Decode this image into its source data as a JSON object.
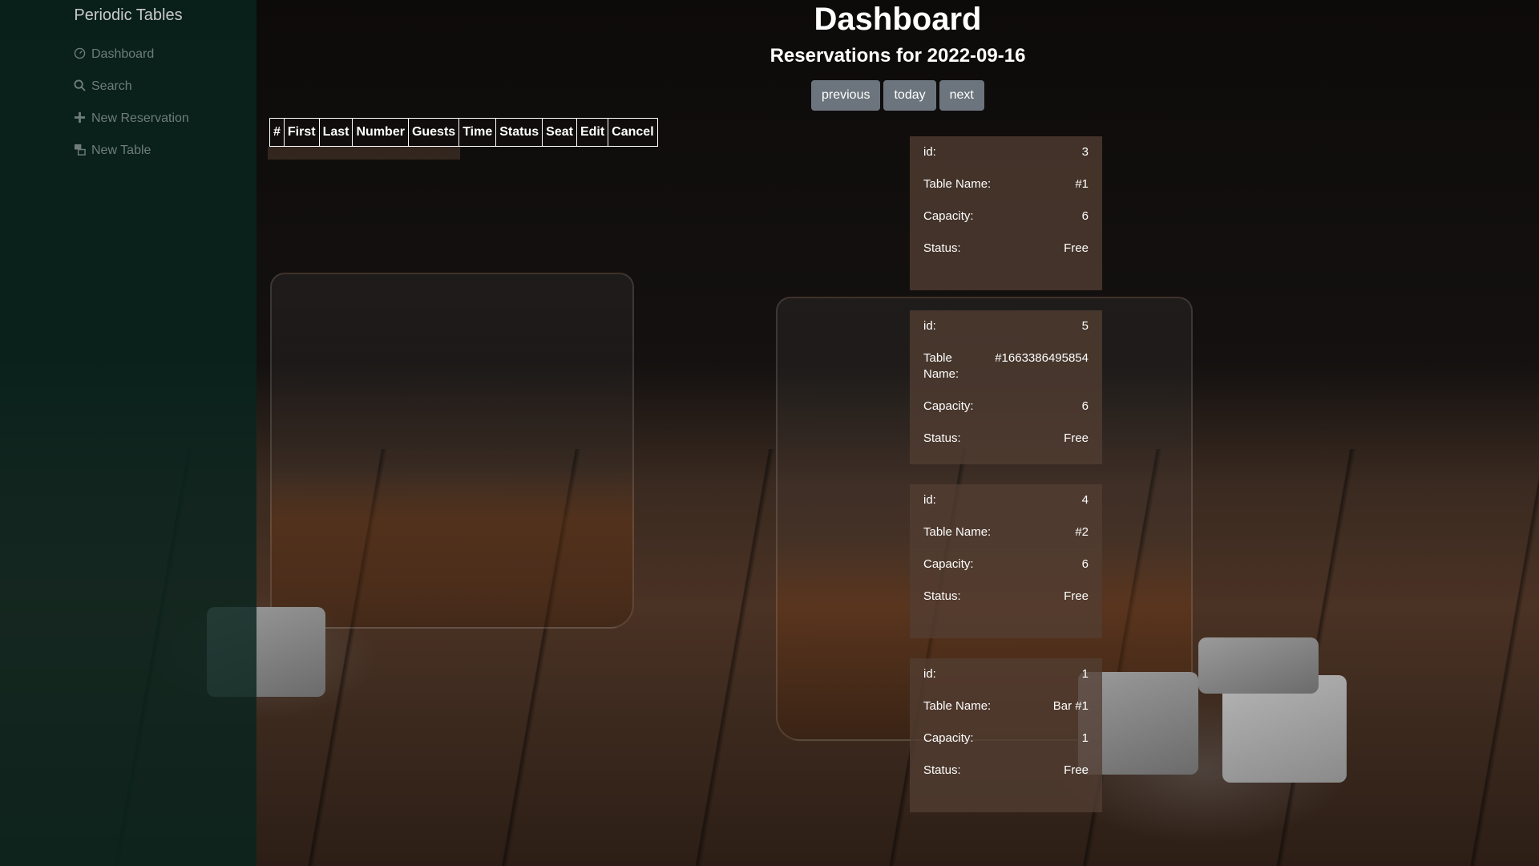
{
  "sidebar": {
    "brand": "Periodic Tables",
    "items": [
      {
        "label": "Dashboard",
        "icon": "dashboard-icon"
      },
      {
        "label": "Search",
        "icon": "search-icon"
      },
      {
        "label": "New Reservation",
        "icon": "plus-icon"
      },
      {
        "label": "New Table",
        "icon": "table-icon"
      }
    ]
  },
  "main": {
    "title": "Dashboard",
    "subtitle": "Reservations for 2022-09-16",
    "buttons": {
      "previous": "previous",
      "today": "today",
      "next": "next"
    },
    "reservations_table": {
      "headers": [
        "#",
        "First",
        "Last",
        "Number",
        "Guests",
        "Time",
        "Status",
        "Seat",
        "Edit",
        "Cancel"
      ],
      "rows": []
    },
    "tables": [
      {
        "id_label": "id:",
        "id": "3",
        "name_label": "Table Name:",
        "name": "#1",
        "capacity_label": "Capacity:",
        "capacity": "6",
        "status_label": "Status:",
        "status": "Free"
      },
      {
        "id_label": "id:",
        "id": "5",
        "name_label": "Table Name:",
        "name": "#1663386495854",
        "capacity_label": "Capacity:",
        "capacity": "6",
        "status_label": "Status:",
        "status": "Free"
      },
      {
        "id_label": "id:",
        "id": "4",
        "name_label": "Table Name:",
        "name": "#2",
        "capacity_label": "Capacity:",
        "capacity": "6",
        "status_label": "Status:",
        "status": "Free"
      },
      {
        "id_label": "id:",
        "id": "1",
        "name_label": "Table Name:",
        "name": "Bar #1",
        "capacity_label": "Capacity:",
        "capacity": "1",
        "status_label": "Status:",
        "status": "Free"
      }
    ]
  },
  "colors": {
    "sidebar_bg": "#08241e",
    "button_bg": "#6c757d",
    "card_bg": "#523e32",
    "text": "#ffffff",
    "nav_text": "#6f7d78"
  }
}
